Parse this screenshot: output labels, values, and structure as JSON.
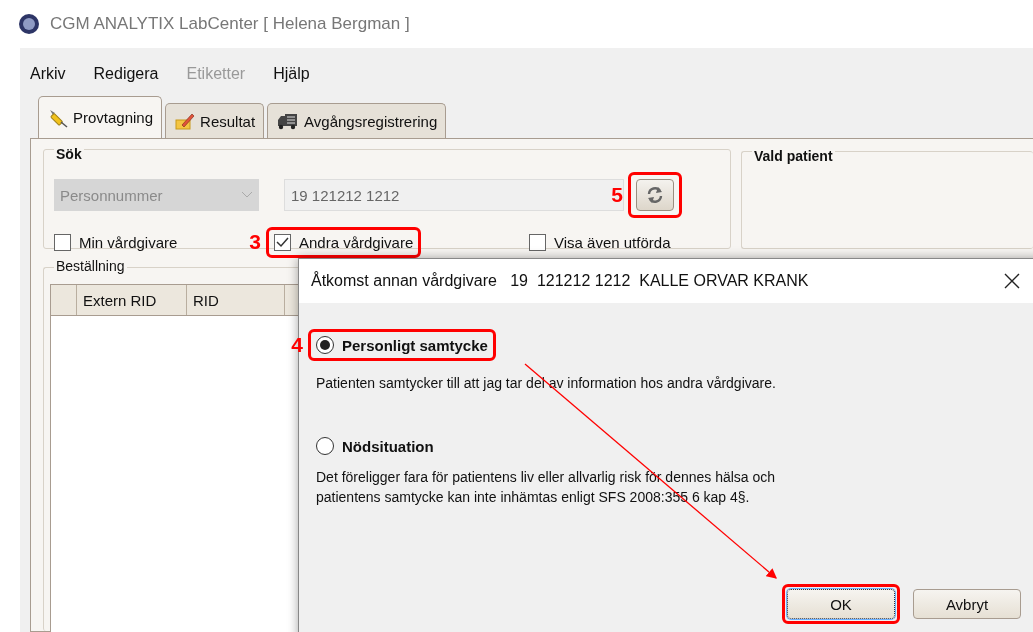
{
  "window": {
    "title": "CGM ANALYTIX LabCenter [ Helena Bergman ]"
  },
  "menu": [
    {
      "label": "Arkiv",
      "disabled": false
    },
    {
      "label": "Redigera",
      "disabled": false
    },
    {
      "label": "Etiketter",
      "disabled": true
    },
    {
      "label": "Hjälp",
      "disabled": false
    }
  ],
  "tabs": [
    {
      "label": "Provtagning",
      "selected": true
    },
    {
      "label": "Resultat",
      "selected": false
    },
    {
      "label": "Avgångsregistrering",
      "selected": false
    }
  ],
  "search": {
    "title": "Sök",
    "id_type": {
      "value": "Personnummer",
      "disabled": true
    },
    "id_field": {
      "value": "19  121212 1212"
    },
    "checkboxes": [
      {
        "label": "Min vårdgivare",
        "checked": false
      },
      {
        "label": "Andra vårdgivare",
        "checked": true,
        "callout": "3"
      },
      {
        "label": "Visa även utförda",
        "checked": false
      }
    ],
    "refresh_button": {
      "callout": "5"
    }
  },
  "selected_patient": {
    "title": "Vald patient"
  },
  "order": {
    "title": "Beställning",
    "columns": [
      "Extern RID",
      "RID"
    ]
  },
  "dialog": {
    "title": "Åtkomst annan vårdgivare   19  121212 1212  KALLE ORVAR KRANK",
    "options": [
      {
        "label": "Personligt samtycke",
        "selected": true,
        "callout": "4",
        "description": "Patienten samtycker till att jag tar del av information hos andra vårdgivare."
      },
      {
        "label": "Nödsituation",
        "selected": false,
        "description": "Det föreligger fara för patientens liv eller allvarlig risk för dennes hälsa och\npatientens samtycke kan inte inhämtas enligt SFS 2008:355 6 kap 4§."
      }
    ],
    "buttons": [
      {
        "label": "OK",
        "highlighted": true
      },
      {
        "label": "Avbryt",
        "highlighted": false
      }
    ]
  }
}
